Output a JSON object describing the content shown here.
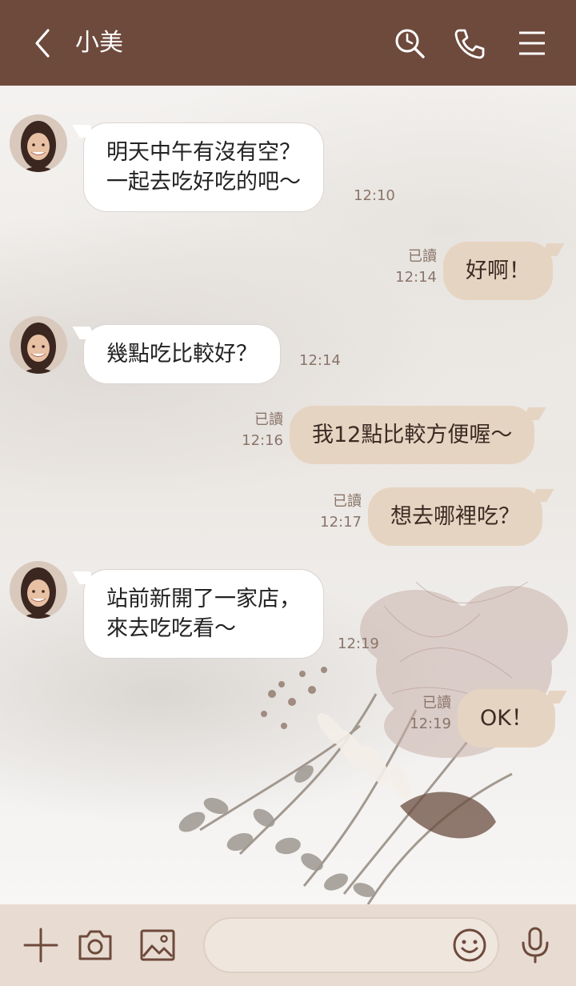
{
  "header": {
    "title": "小美",
    "icons": [
      "back-icon",
      "search-icon",
      "phone-icon",
      "menu-icon"
    ]
  },
  "messages": [
    {
      "from": "contact",
      "text": "明天中午有沒有空？\n一起去吃好吃的吧～",
      "time": "12:10"
    },
    {
      "from": "me",
      "text": "好啊！",
      "read": "已讀",
      "time": "12:14"
    },
    {
      "from": "contact",
      "text": "幾點吃比較好？",
      "time": "12:14"
    },
    {
      "from": "me",
      "text": "我12點比較方便喔～",
      "read": "已讀",
      "time": "12:16"
    },
    {
      "from": "me",
      "text": "想去哪裡吃？",
      "read": "已讀",
      "time": "12:17"
    },
    {
      "from": "contact",
      "text": "站前新開了一家店，\n來去吃吃看～",
      "time": "12:19"
    },
    {
      "from": "me",
      "text": "OK！",
      "read": "已讀",
      "time": "12:19"
    }
  ],
  "composer": {
    "placeholder": "",
    "icons": [
      "plus-icon",
      "camera-icon",
      "image-icon",
      "emoji-icon",
      "microphone-icon"
    ]
  },
  "colors": {
    "header_bg": "#6e4a3c",
    "outgoing_bubble": "#e6d4c2",
    "incoming_bubble": "#ffffff",
    "meta_text": "#8a756a",
    "bottom_bar": "#e8dcd2"
  }
}
